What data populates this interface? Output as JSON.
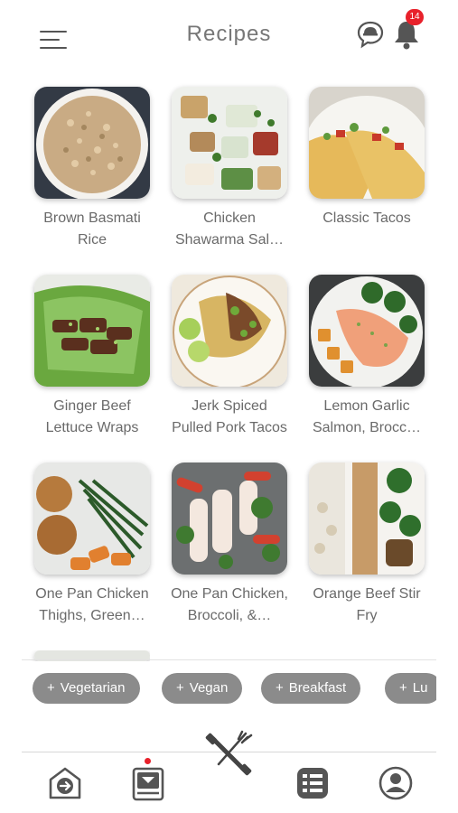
{
  "header": {
    "title": "Recipes",
    "notification_count": "14",
    "menu_icon": "hamburger-menu-icon",
    "chat_icon": "chat-help-icon",
    "bell_icon": "bell-icon"
  },
  "recipes": [
    {
      "name": "Brown Basmati Rice",
      "line1": "Brown Basmati",
      "line2": "Rice"
    },
    {
      "name": "Chicken Shawarma Sal…",
      "line1": "Chicken",
      "line2": "Shawarma Sal…"
    },
    {
      "name": "Classic Tacos",
      "line1": "Classic Tacos",
      "line2": ""
    },
    {
      "name": "Ginger Beef Lettuce Wraps",
      "line1": "Ginger Beef",
      "line2": "Lettuce Wraps"
    },
    {
      "name": "Jerk Spiced Pulled Pork Tacos",
      "line1": "Jerk Spiced",
      "line2": "Pulled Pork Tacos"
    },
    {
      "name": "Lemon Garlic Salmon, Brocc…",
      "line1": "Lemon Garlic",
      "line2": "Salmon, Brocc…"
    },
    {
      "name": "One Pan Chicken Thighs, Green…",
      "line1": "One Pan Chicken",
      "line2": "Thighs, Green…"
    },
    {
      "name": "One Pan Chicken, Broccoli, &…",
      "line1": "One Pan Chicken,",
      "line2": "Broccoli, &…"
    },
    {
      "name": "Orange Beef Stir Fry",
      "line1": "Orange Beef Stir",
      "line2": "Fry"
    }
  ],
  "filters": {
    "chips": [
      "Vegetarian",
      "Vegan",
      "Breakfast",
      "Lu"
    ],
    "plus": "+"
  },
  "bottom_nav": {
    "items": [
      {
        "icon": "home-arrow-icon"
      },
      {
        "icon": "recipe-book-icon"
      },
      {
        "icon": "fitness-utensils-icon"
      },
      {
        "icon": "list-icon"
      },
      {
        "icon": "profile-icon"
      }
    ]
  },
  "colors": {
    "badge": "#e8212b",
    "chip_bg": "#8b8b8b",
    "icon": "#555555"
  }
}
